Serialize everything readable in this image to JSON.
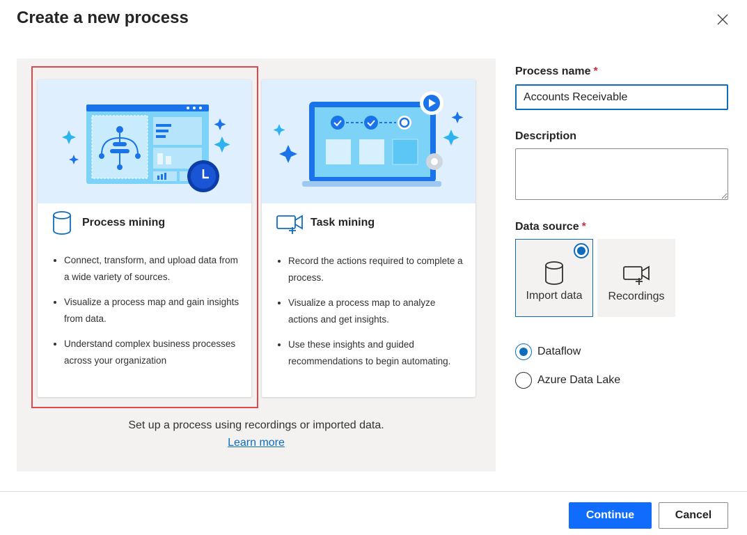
{
  "dialog": {
    "title": "Create a new process"
  },
  "cards": [
    {
      "title": "Process mining",
      "icon": "database-icon",
      "bullets": [
        "Connect, transform, and upload data from a wide variety of sources.",
        "Visualize a process map and gain insights from data.",
        "Understand complex business processes across your organization"
      ],
      "selected": true
    },
    {
      "title": "Task mining",
      "icon": "video-camera-add-icon",
      "bullets": [
        "Record the actions required to complete a process.",
        "Visualize a process map to analyze actions and get insights.",
        "Use these insights and guided recommendations to begin automating."
      ],
      "selected": false
    }
  ],
  "panel_footer": {
    "text": "Set up a process using recordings or imported data.",
    "link": "Learn more"
  },
  "form": {
    "process_name": {
      "label": "Process name",
      "required_mark": "*",
      "value": "Accounts Receivable"
    },
    "description": {
      "label": "Description",
      "value": ""
    },
    "data_source": {
      "label": "Data source",
      "required_mark": "*",
      "options": [
        {
          "label": "Import data",
          "icon": "database-icon",
          "selected": true
        },
        {
          "label": "Recordings",
          "icon": "video-camera-add-icon",
          "selected": false
        }
      ]
    },
    "storage": [
      {
        "label": "Dataflow",
        "checked": true
      },
      {
        "label": "Azure Data Lake",
        "checked": false
      }
    ]
  },
  "buttons": {
    "continue": "Continue",
    "cancel": "Cancel"
  },
  "colors": {
    "accent": "#0f6cbd",
    "primary_button": "#0f6cfd",
    "selection_outline": "#e0484d",
    "panel_bg": "#f3f2f1"
  }
}
